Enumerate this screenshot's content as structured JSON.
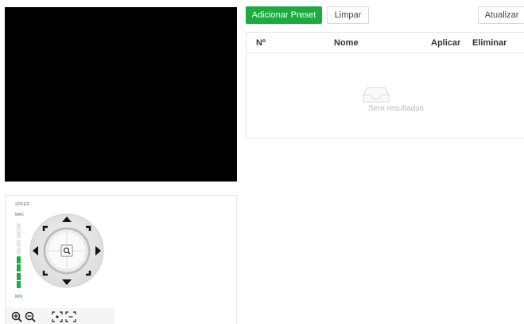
{
  "toolbar": {
    "add_preset": "Adicionar Preset",
    "clear": "Limpar",
    "refresh": "Atualizar"
  },
  "table": {
    "columns": [
      "Nº",
      "Nome",
      "Aplicar",
      "Eliminar"
    ],
    "rows": [],
    "empty_text": "Sem resultados"
  },
  "ptz": {
    "speed_label": "SPEED",
    "max_label": "MAX",
    "min_label": "MIN",
    "speed_level": 0.55
  },
  "colors": {
    "accent": "#1aac3f",
    "video_bg": "#000000"
  },
  "icons": [
    "zoom-in-icon",
    "zoom-out-icon",
    "focus-near-icon",
    "focus-far-icon",
    "up-arrow-icon",
    "down-arrow-icon",
    "left-arrow-icon",
    "right-arrow-icon",
    "auto-focus-icon",
    "inbox-empty-icon"
  ]
}
